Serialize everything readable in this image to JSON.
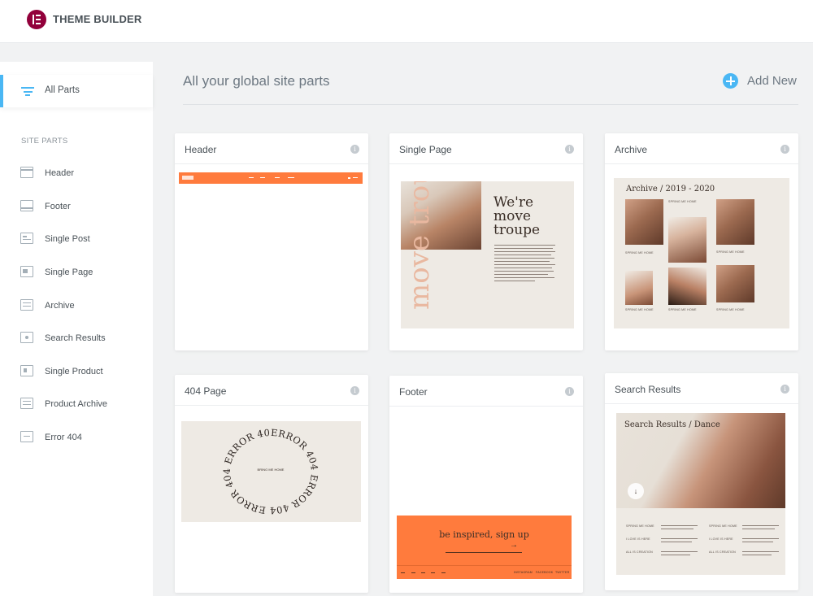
{
  "app": {
    "title": "THEME BUILDER"
  },
  "sidebar": {
    "all_parts": "All Parts",
    "section_title": "SITE PARTS",
    "items": [
      {
        "label": "Header"
      },
      {
        "label": "Footer"
      },
      {
        "label": "Single Post"
      },
      {
        "label": "Single Page"
      },
      {
        "label": "Archive"
      },
      {
        "label": "Search Results"
      },
      {
        "label": "Single Product"
      },
      {
        "label": "Product Archive"
      },
      {
        "label": "Error 404"
      }
    ]
  },
  "main": {
    "title": "All your global site parts",
    "add_new": "Add New",
    "cards": [
      {
        "name": "Header",
        "info": "i"
      },
      {
        "name": "Single Page",
        "info": "i"
      },
      {
        "name": "Archive",
        "info": "i"
      },
      {
        "name": "404 Page",
        "info": "i"
      },
      {
        "name": "Footer",
        "info": "i"
      },
      {
        "name": "Search Results",
        "info": "i"
      }
    ]
  },
  "previews": {
    "single_page": {
      "headline": "We're move troupe",
      "vertical_text": "move troupe"
    },
    "archive": {
      "title": "Archive / 2019 - 2020",
      "captions": [
        "SPRING ME HOME",
        "SPRING ME HOME",
        "SPRING ME HOME",
        "SPRING ME HOME",
        "SPRING ME HOME",
        "SPRING ME HOME"
      ]
    },
    "error404": {
      "ring_text": "ERROR 404 ERROR 404 ERROR 404 ERROR 404 ",
      "center_link": "BRING ME HOME"
    },
    "footer": {
      "cta": "be inspired, sign up",
      "arrow": "→",
      "links_right": [
        "INSTAGRAM",
        "FACEBOOK",
        "TWITTER"
      ]
    },
    "search": {
      "title": "Search Results / Dance",
      "scroll_arrow": "↓",
      "rows": [
        "SPRING ME HOME",
        "I LOVE IS HERE",
        "ALL IS CREATION"
      ]
    }
  },
  "colors": {
    "accent_blue": "#4ab7f4",
    "brand": "#92003b",
    "orange": "#ff7b3d"
  }
}
